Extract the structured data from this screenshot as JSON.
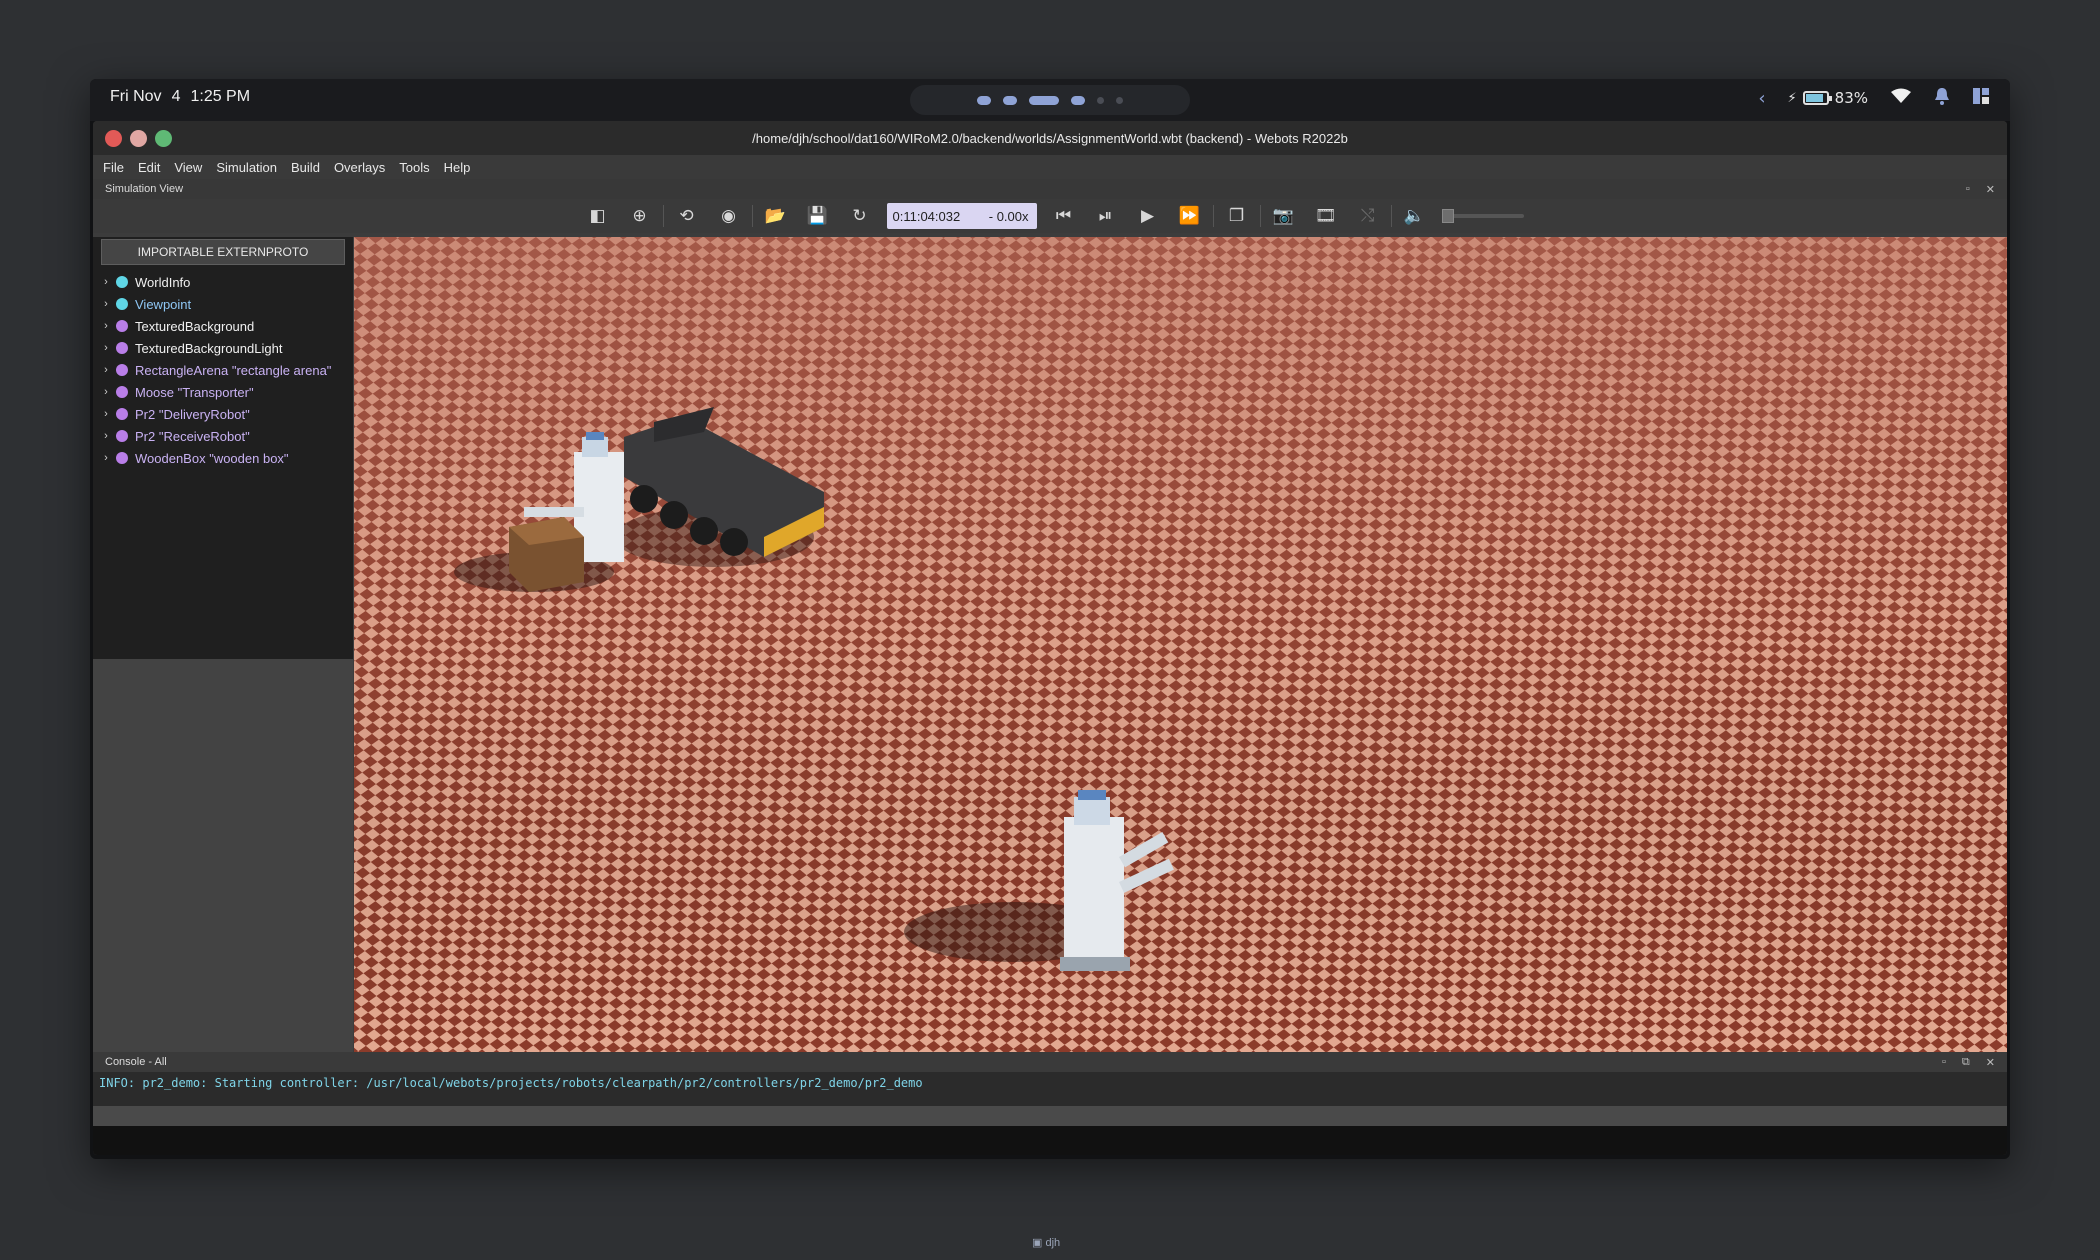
{
  "statusbar": {
    "day": "Fri Nov",
    "date": "4",
    "time": "1:25 PM",
    "battery": "83%",
    "battery_level": 0.83
  },
  "window": {
    "title": "/home/djh/school/dat160/WIRoM2.0/backend/worlds/AssignmentWorld.wbt (backend) - Webots R2022b"
  },
  "menu": [
    "File",
    "Edit",
    "View",
    "Simulation",
    "Build",
    "Overlays",
    "Tools",
    "Help"
  ],
  "simulation_view": {
    "label": "Simulation View"
  },
  "toolbar": {
    "time": "0:11:04:032",
    "speed": "-  0.00x"
  },
  "sidebar": {
    "extern_button": "IMPORTABLE EXTERNPROTO",
    "items": [
      {
        "label": "WorldInfo",
        "bullet": "cyan",
        "color": "white"
      },
      {
        "label": "Viewpoint",
        "bullet": "cyan",
        "color": "blue"
      },
      {
        "label": "TexturedBackground",
        "bullet": "violet",
        "color": "white"
      },
      {
        "label": "TexturedBackgroundLight",
        "bullet": "violet",
        "color": "white"
      },
      {
        "label": "RectangleArena \"rectangle arena\"",
        "bullet": "violet",
        "color": "purple"
      },
      {
        "label": "Moose \"Transporter\"",
        "bullet": "violet",
        "color": "purple"
      },
      {
        "label": "Pr2 \"DeliveryRobot\"",
        "bullet": "violet",
        "color": "purple"
      },
      {
        "label": "Pr2 \"ReceiveRobot\"",
        "bullet": "violet",
        "color": "purple"
      },
      {
        "label": "WoodenBox \"wooden box\"",
        "bullet": "violet",
        "color": "purple"
      }
    ]
  },
  "console": {
    "title": "Console - All",
    "line": "INFO: pr2_demo: Starting controller: /usr/local/webots/projects/robots/clearpath/pr2/controllers/pr2_demo/pr2_demo"
  },
  "user": "djh"
}
